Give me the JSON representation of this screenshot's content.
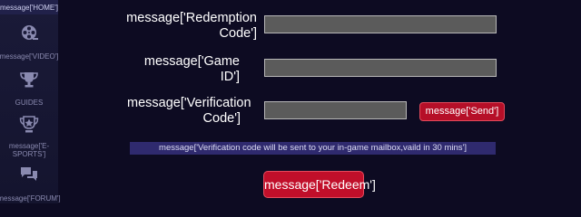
{
  "sidebar": {
    "items": [
      {
        "label": "message['HOME']",
        "icon": "home-icon",
        "active": true
      },
      {
        "label": "message['VIDEO']",
        "icon": "film-reel-icon"
      },
      {
        "label": "GUIDES",
        "icon": "trophy-icon"
      },
      {
        "label": "message['E-SPORTS']",
        "icon": "esports-trophy-icon"
      },
      {
        "label": "message['FORUM']",
        "icon": "chat-bubbles-icon"
      }
    ]
  },
  "form": {
    "redemption_code_label": "message['Redemption Code']",
    "redemption_code_value": "",
    "game_id_label": "message['Game ID']",
    "game_id_value": "",
    "verification_code_label": "message['Verification Code']",
    "verification_code_value": "",
    "send_label": "message['Send']",
    "notice": "message['Verification code will be sent to your in-game mailbox,vaild in 30 mins']",
    "redeem_label": "message['Redeem']"
  },
  "colors": {
    "background": "#0d0b22",
    "sidebar": "#1a1a38",
    "accent_red": "#c10f2a",
    "notice_bg": "#2f2a6e",
    "input_bg": "#5b5b5b"
  }
}
